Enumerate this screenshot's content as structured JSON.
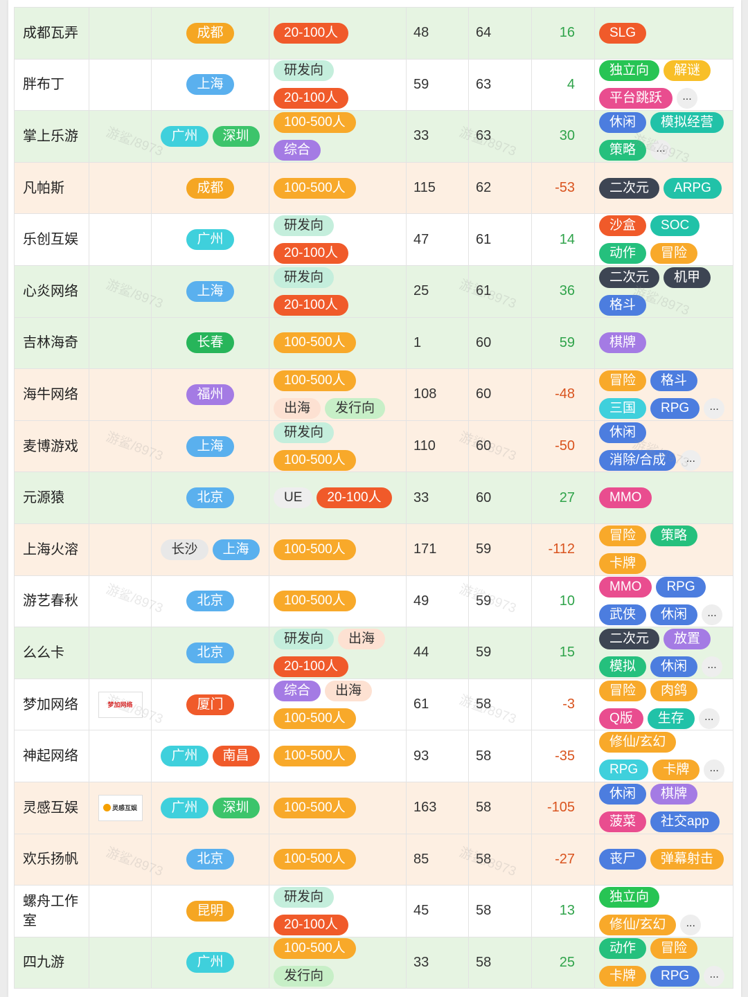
{
  "watermark": "游鲨/8973",
  "rows": [
    {
      "name": "成都瓦弄",
      "logo": null,
      "bg": "green",
      "cities": [
        {
          "t": "成都",
          "c": "#f5a623"
        }
      ],
      "scale": [
        [
          {
            "t": "20-100人",
            "c": "#f05a2a"
          }
        ]
      ],
      "a": "48",
      "b": "64",
      "diff": "16",
      "sign": "pos",
      "genres": [
        [
          {
            "t": "SLG",
            "c": "#f05a2a"
          }
        ]
      ]
    },
    {
      "name": "胖布丁",
      "logo": null,
      "bg": "white",
      "cities": [
        {
          "t": "上海",
          "c": "#5ab0ee"
        }
      ],
      "scale": [
        [
          {
            "t": "研发向",
            "c": "#c4eedc",
            "dark": true
          }
        ],
        [
          {
            "t": "20-100人",
            "c": "#f05a2a"
          }
        ]
      ],
      "a": "59",
      "b": "63",
      "diff": "4",
      "sign": "pos",
      "genres": [
        [
          {
            "t": "独立向",
            "c": "#27c454"
          },
          {
            "t": "解谜",
            "c": "#f8bf28"
          }
        ],
        [
          {
            "t": "平台跳跃",
            "c": "#e94d8f"
          }
        ]
      ],
      "more": true
    },
    {
      "name": "掌上乐游",
      "logo": null,
      "bg": "green",
      "cities": [
        {
          "t": "广州",
          "c": "#3fd0dc"
        },
        {
          "t": "深圳",
          "c": "#3cc46b"
        }
      ],
      "scale": [
        [
          {
            "t": "100-500人",
            "c": "#f8a92a"
          }
        ],
        [
          {
            "t": "综合",
            "c": "#a47be4"
          }
        ]
      ],
      "a": "33",
      "b": "63",
      "diff": "30",
      "sign": "pos",
      "genres": [
        [
          {
            "t": "休闲",
            "c": "#4c7ddf"
          },
          {
            "t": "模拟经营",
            "c": "#21c2a8"
          }
        ],
        [
          {
            "t": "策略",
            "c": "#25c07d"
          }
        ]
      ],
      "more": true
    },
    {
      "name": "凡帕斯",
      "logo": null,
      "bg": "orange",
      "cities": [
        {
          "t": "成都",
          "c": "#f5a623"
        }
      ],
      "scale": [
        [
          {
            "t": "100-500人",
            "c": "#f8a92a"
          }
        ]
      ],
      "a": "115",
      "b": "62",
      "diff": "-53",
      "sign": "neg",
      "genres": [
        [
          {
            "t": "二次元",
            "c": "#3d4553"
          },
          {
            "t": "ARPG",
            "c": "#21c2a8"
          }
        ]
      ]
    },
    {
      "name": "乐创互娱",
      "logo": null,
      "bg": "white",
      "cities": [
        {
          "t": "广州",
          "c": "#3fd0dc"
        }
      ],
      "scale": [
        [
          {
            "t": "研发向",
            "c": "#c4eedc",
            "dark": true
          }
        ],
        [
          {
            "t": "20-100人",
            "c": "#f05a2a"
          }
        ]
      ],
      "a": "47",
      "b": "61",
      "diff": "14",
      "sign": "pos",
      "genres": [
        [
          {
            "t": "沙盒",
            "c": "#f05a2a"
          },
          {
            "t": "SOC",
            "c": "#21c2a8"
          }
        ],
        [
          {
            "t": "动作",
            "c": "#25c07d"
          },
          {
            "t": "冒险",
            "c": "#f8a92a"
          }
        ]
      ]
    },
    {
      "name": "心炎网络",
      "logo": null,
      "bg": "green",
      "cities": [
        {
          "t": "上海",
          "c": "#5ab0ee"
        }
      ],
      "scale": [
        [
          {
            "t": "研发向",
            "c": "#c4eedc",
            "dark": true
          }
        ],
        [
          {
            "t": "20-100人",
            "c": "#f05a2a"
          }
        ]
      ],
      "a": "25",
      "b": "61",
      "diff": "36",
      "sign": "pos",
      "genres": [
        [
          {
            "t": "二次元",
            "c": "#3d4553"
          },
          {
            "t": "机甲",
            "c": "#3d4553"
          }
        ],
        [
          {
            "t": "格斗",
            "c": "#4c7ddf"
          }
        ]
      ]
    },
    {
      "name": "吉林海奇",
      "logo": null,
      "bg": "green",
      "cities": [
        {
          "t": "长春",
          "c": "#27b55a"
        }
      ],
      "scale": [
        [
          {
            "t": "100-500人",
            "c": "#f8a92a"
          }
        ]
      ],
      "a": "1",
      "b": "60",
      "diff": "59",
      "sign": "pos",
      "genres": [
        [
          {
            "t": "棋牌",
            "c": "#a47be4"
          }
        ]
      ]
    },
    {
      "name": "海牛网络",
      "logo": null,
      "bg": "orange",
      "cities": [
        {
          "t": "福州",
          "c": "#a47be4"
        }
      ],
      "scale": [
        [
          {
            "t": "100-500人",
            "c": "#f8a92a"
          }
        ],
        [
          {
            "t": "出海",
            "c": "#fde1d2",
            "dark": true
          },
          {
            "t": "发行向",
            "c": "#c7efc7",
            "dark": true
          }
        ]
      ],
      "a": "108",
      "b": "60",
      "diff": "-48",
      "sign": "neg",
      "genres": [
        [
          {
            "t": "冒险",
            "c": "#f8a92a"
          },
          {
            "t": "格斗",
            "c": "#4c7ddf"
          }
        ],
        [
          {
            "t": "三国",
            "c": "#3fd0dc"
          },
          {
            "t": "RPG",
            "c": "#4c7ddf"
          }
        ]
      ],
      "more": true
    },
    {
      "name": "麦博游戏",
      "logo": null,
      "bg": "orange",
      "cities": [
        {
          "t": "上海",
          "c": "#5ab0ee"
        }
      ],
      "scale": [
        [
          {
            "t": "研发向",
            "c": "#c4eedc",
            "dark": true
          }
        ],
        [
          {
            "t": "100-500人",
            "c": "#f8a92a"
          }
        ]
      ],
      "a": "110",
      "b": "60",
      "diff": "-50",
      "sign": "neg",
      "genres": [
        [
          {
            "t": "休闲",
            "c": "#4c7ddf"
          }
        ],
        [
          {
            "t": "消除/合成",
            "c": "#4c7ddf"
          }
        ]
      ],
      "more": true
    },
    {
      "name": "元源猿",
      "logo": null,
      "bg": "green",
      "cities": [
        {
          "t": "北京",
          "c": "#5ab0ee"
        }
      ],
      "scale": [
        [
          {
            "t": "UE",
            "c": "#eeeeee",
            "dark": true
          },
          {
            "t": "20-100人",
            "c": "#f05a2a"
          }
        ]
      ],
      "a": "33",
      "b": "60",
      "diff": "27",
      "sign": "pos",
      "genres": [
        [
          {
            "t": "MMO",
            "c": "#e94d8f"
          }
        ]
      ]
    },
    {
      "name": "上海火溶",
      "logo": null,
      "bg": "orange",
      "cities": [
        {
          "t": "长沙",
          "c": "#e8e8e8",
          "dark": true
        },
        {
          "t": "上海",
          "c": "#5ab0ee"
        }
      ],
      "scale": [
        [
          {
            "t": "100-500人",
            "c": "#f8a92a"
          }
        ]
      ],
      "a": "171",
      "b": "59",
      "diff": "-112",
      "sign": "neg",
      "genres": [
        [
          {
            "t": "冒险",
            "c": "#f8a92a"
          },
          {
            "t": "策略",
            "c": "#25c07d"
          }
        ],
        [
          {
            "t": "卡牌",
            "c": "#f8a92a"
          }
        ]
      ]
    },
    {
      "name": "游艺春秋",
      "logo": null,
      "bg": "white",
      "cities": [
        {
          "t": "北京",
          "c": "#5ab0ee"
        }
      ],
      "scale": [
        [
          {
            "t": "100-500人",
            "c": "#f8a92a"
          }
        ]
      ],
      "a": "49",
      "b": "59",
      "diff": "10",
      "sign": "pos",
      "genres": [
        [
          {
            "t": "MMO",
            "c": "#e94d8f"
          },
          {
            "t": "RPG",
            "c": "#4c7ddf"
          }
        ],
        [
          {
            "t": "武侠",
            "c": "#4c7ddf"
          },
          {
            "t": "休闲",
            "c": "#4c7ddf"
          }
        ]
      ],
      "more": true
    },
    {
      "name": "么么卡",
      "logo": null,
      "bg": "green",
      "cities": [
        {
          "t": "北京",
          "c": "#5ab0ee"
        }
      ],
      "scale": [
        [
          {
            "t": "研发向",
            "c": "#c4eedc",
            "dark": true
          },
          {
            "t": "出海",
            "c": "#fde1d2",
            "dark": true
          }
        ],
        [
          {
            "t": "20-100人",
            "c": "#f05a2a"
          }
        ]
      ],
      "a": "44",
      "b": "59",
      "diff": "15",
      "sign": "pos",
      "genres": [
        [
          {
            "t": "二次元",
            "c": "#3d4553"
          },
          {
            "t": "放置",
            "c": "#a47be4"
          }
        ],
        [
          {
            "t": "模拟",
            "c": "#25c07d"
          },
          {
            "t": "休闲",
            "c": "#4c7ddf"
          }
        ]
      ],
      "more": true
    },
    {
      "name": "梦加网络",
      "logo": "梦加网络",
      "bg": "white",
      "cities": [
        {
          "t": "厦门",
          "c": "#f05a2a"
        }
      ],
      "scale": [
        [
          {
            "t": "综合",
            "c": "#a47be4"
          },
          {
            "t": "出海",
            "c": "#fde1d2",
            "dark": true
          }
        ],
        [
          {
            "t": "100-500人",
            "c": "#f8a92a"
          }
        ]
      ],
      "a": "61",
      "b": "58",
      "diff": "-3",
      "sign": "neg",
      "genres": [
        [
          {
            "t": "冒险",
            "c": "#f8a92a"
          },
          {
            "t": "肉鸽",
            "c": "#f8a92a"
          }
        ],
        [
          {
            "t": "Q版",
            "c": "#e94d8f"
          },
          {
            "t": "生存",
            "c": "#21c2a8"
          }
        ]
      ],
      "more": true
    },
    {
      "name": "神起网络",
      "logo": null,
      "bg": "white",
      "cities": [
        {
          "t": "广州",
          "c": "#3fd0dc"
        },
        {
          "t": "南昌",
          "c": "#f05a2a"
        }
      ],
      "scale": [
        [
          {
            "t": "100-500人",
            "c": "#f8a92a"
          }
        ]
      ],
      "a": "93",
      "b": "58",
      "diff": "-35",
      "sign": "neg",
      "genres": [
        [
          {
            "t": "修仙/玄幻",
            "c": "#f8a92a"
          }
        ],
        [
          {
            "t": "RPG",
            "c": "#3fd0dc"
          },
          {
            "t": "卡牌",
            "c": "#f8a92a"
          }
        ]
      ],
      "more": true
    },
    {
      "name": "灵感互娱",
      "logo": "灵感互娱",
      "bg": "orange",
      "cities": [
        {
          "t": "广州",
          "c": "#3fd0dc"
        },
        {
          "t": "深圳",
          "c": "#3cc46b"
        }
      ],
      "scale": [
        [
          {
            "t": "100-500人",
            "c": "#f8a92a"
          }
        ]
      ],
      "a": "163",
      "b": "58",
      "diff": "-105",
      "sign": "neg",
      "genres": [
        [
          {
            "t": "休闲",
            "c": "#4c7ddf"
          },
          {
            "t": "棋牌",
            "c": "#a47be4"
          }
        ],
        [
          {
            "t": "菠菜",
            "c": "#e94d8f"
          },
          {
            "t": "社交app",
            "c": "#4c7ddf"
          }
        ]
      ]
    },
    {
      "name": "欢乐扬帆",
      "logo": null,
      "bg": "orange",
      "cities": [
        {
          "t": "北京",
          "c": "#5ab0ee"
        }
      ],
      "scale": [
        [
          {
            "t": "100-500人",
            "c": "#f8a92a"
          }
        ]
      ],
      "a": "85",
      "b": "58",
      "diff": "-27",
      "sign": "neg",
      "genres": [
        [
          {
            "t": "丧尸",
            "c": "#4c7ddf"
          },
          {
            "t": "弹幕射击",
            "c": "#f8a92a"
          }
        ]
      ]
    },
    {
      "name": "螺舟工作室",
      "logo": null,
      "bg": "white",
      "cities": [
        {
          "t": "昆明",
          "c": "#f5a623"
        }
      ],
      "scale": [
        [
          {
            "t": "研发向",
            "c": "#c4eedc",
            "dark": true
          }
        ],
        [
          {
            "t": "20-100人",
            "c": "#f05a2a"
          }
        ]
      ],
      "a": "45",
      "b": "58",
      "diff": "13",
      "sign": "pos",
      "genres": [
        [
          {
            "t": "独立向",
            "c": "#27c454"
          }
        ],
        [
          {
            "t": "修仙/玄幻",
            "c": "#f8a92a"
          }
        ]
      ],
      "more": true
    },
    {
      "name": "四九游",
      "logo": null,
      "bg": "green",
      "cities": [
        {
          "t": "广州",
          "c": "#3fd0dc"
        }
      ],
      "scale": [
        [
          {
            "t": "100-500人",
            "c": "#f8a92a"
          }
        ],
        [
          {
            "t": "发行向",
            "c": "#c7efc7",
            "dark": true
          }
        ]
      ],
      "a": "33",
      "b": "58",
      "diff": "25",
      "sign": "pos",
      "genres": [
        [
          {
            "t": "动作",
            "c": "#25c07d"
          },
          {
            "t": "冒险",
            "c": "#f8a92a"
          }
        ],
        [
          {
            "t": "卡牌",
            "c": "#f8a92a"
          },
          {
            "t": "RPG",
            "c": "#4c7ddf"
          }
        ]
      ],
      "more": true
    }
  ]
}
